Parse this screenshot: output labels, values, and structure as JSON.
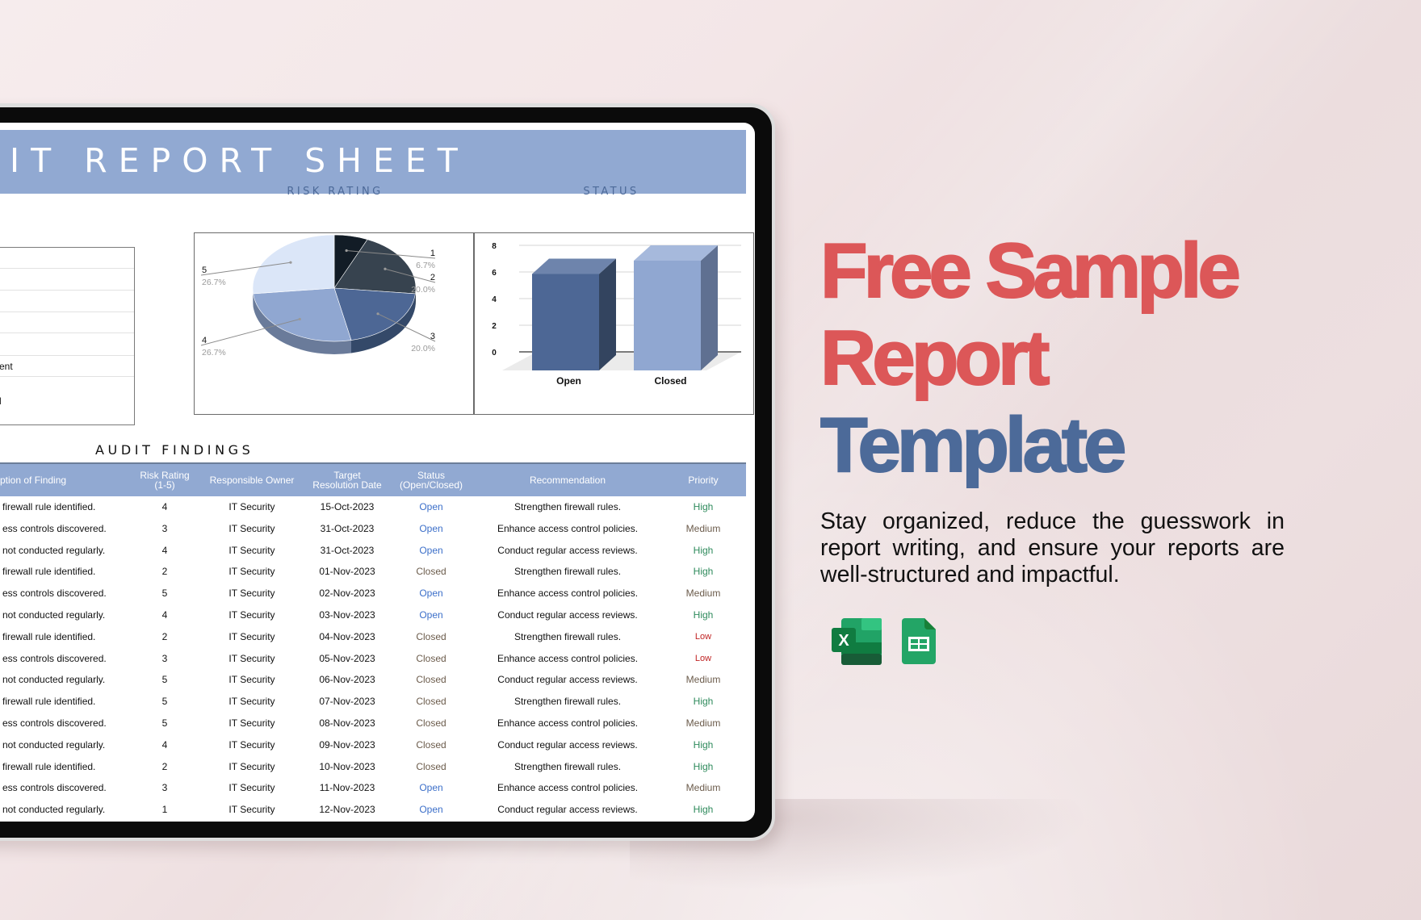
{
  "sheet": {
    "title": "IT REPORT SHEET",
    "risk_rating_label": "RISK RATING",
    "status_label": "STATUS",
    "summary_rows": [
      "",
      "",
      "",
      "",
      "",
      "ent",
      "l"
    ],
    "audit_findings_label": "AUDIT FINDINGS",
    "table": {
      "columns": [
        "ption of Finding",
        "Risk Rating\n(1-5)",
        "Responsible Owner",
        "Target\nResolution Date",
        "Status\n(Open/Closed)",
        "Recommendation",
        "Priority"
      ],
      "rows": [
        {
          "desc": "firewall rule identified.",
          "risk": "4",
          "owner": "IT Security",
          "date": "15-Oct-2023",
          "status": "Open",
          "rec": "Strengthen firewall rules.",
          "priority": "High"
        },
        {
          "desc": "ess controls discovered.",
          "risk": "3",
          "owner": "IT Security",
          "date": "31-Oct-2023",
          "status": "Open",
          "rec": "Enhance access control policies.",
          "priority": "Medium"
        },
        {
          "desc": "not conducted regularly.",
          "risk": "4",
          "owner": "IT Security",
          "date": "31-Oct-2023",
          "status": "Open",
          "rec": "Conduct regular access reviews.",
          "priority": "High"
        },
        {
          "desc": "firewall rule identified.",
          "risk": "2",
          "owner": "IT Security",
          "date": "01-Nov-2023",
          "status": "Closed",
          "rec": "Strengthen firewall rules.",
          "priority": "High"
        },
        {
          "desc": "ess controls discovered.",
          "risk": "5",
          "owner": "IT Security",
          "date": "02-Nov-2023",
          "status": "Open",
          "rec": "Enhance access control policies.",
          "priority": "Medium"
        },
        {
          "desc": "not conducted regularly.",
          "risk": "4",
          "owner": "IT Security",
          "date": "03-Nov-2023",
          "status": "Open",
          "rec": "Conduct regular access reviews.",
          "priority": "High"
        },
        {
          "desc": "firewall rule identified.",
          "risk": "2",
          "owner": "IT Security",
          "date": "04-Nov-2023",
          "status": "Closed",
          "rec": "Strengthen firewall rules.",
          "priority": "Low"
        },
        {
          "desc": "ess controls discovered.",
          "risk": "3",
          "owner": "IT Security",
          "date": "05-Nov-2023",
          "status": "Closed",
          "rec": "Enhance access control policies.",
          "priority": "Low"
        },
        {
          "desc": "not conducted regularly.",
          "risk": "5",
          "owner": "IT Security",
          "date": "06-Nov-2023",
          "status": "Closed",
          "rec": "Conduct regular access reviews.",
          "priority": "Medium"
        },
        {
          "desc": "firewall rule identified.",
          "risk": "5",
          "owner": "IT Security",
          "date": "07-Nov-2023",
          "status": "Closed",
          "rec": "Strengthen firewall rules.",
          "priority": "High"
        },
        {
          "desc": "ess controls discovered.",
          "risk": "5",
          "owner": "IT Security",
          "date": "08-Nov-2023",
          "status": "Closed",
          "rec": "Enhance access control policies.",
          "priority": "Medium"
        },
        {
          "desc": "not conducted regularly.",
          "risk": "4",
          "owner": "IT Security",
          "date": "09-Nov-2023",
          "status": "Closed",
          "rec": "Conduct regular access reviews.",
          "priority": "High"
        },
        {
          "desc": "firewall rule identified.",
          "risk": "2",
          "owner": "IT Security",
          "date": "10-Nov-2023",
          "status": "Closed",
          "rec": "Strengthen firewall rules.",
          "priority": "High"
        },
        {
          "desc": "ess controls discovered.",
          "risk": "3",
          "owner": "IT Security",
          "date": "11-Nov-2023",
          "status": "Open",
          "rec": "Enhance access control policies.",
          "priority": "Medium"
        },
        {
          "desc": "not conducted regularly.",
          "risk": "1",
          "owner": "IT Security",
          "date": "12-Nov-2023",
          "status": "Open",
          "rec": "Conduct regular access reviews.",
          "priority": "High"
        }
      ]
    }
  },
  "chart_data": [
    {
      "type": "pie",
      "title": "RISK RATING",
      "categories": [
        "1",
        "2",
        "3",
        "4",
        "5"
      ],
      "values": [
        1,
        3,
        3,
        4,
        4
      ],
      "percent_labels": [
        "6.7%",
        "20.0%",
        "20.0%",
        "26.7%",
        "26.7%"
      ],
      "colors": [
        "#121c26",
        "#37434f",
        "#4d6795",
        "#90a7d1",
        "#dbe6f8"
      ],
      "side_colors": [
        "#0b1118",
        "#262f38",
        "#344969",
        "#6a7b9a",
        "#a9b6cc"
      ],
      "three_d": true
    },
    {
      "type": "bar",
      "title": "STATUS",
      "categories": [
        "Open",
        "Closed"
      ],
      "values": [
        7,
        8
      ],
      "colors": [
        "#4d6795",
        "#90a7d1"
      ],
      "ylim": [
        0,
        8
      ],
      "yticks": [
        "0",
        "2",
        "4",
        "6",
        "8"
      ],
      "grid": true,
      "three_d": true
    }
  ],
  "promo": {
    "title_line1": "Free Sample",
    "title_line2": "Report",
    "title_line3": "Template",
    "description": "Stay organized, reduce the guesswork in report writing, and ensure your reports are well-structured and impactful.",
    "colors": {
      "red": "#dc5758",
      "blue": "#4c6a99"
    },
    "icons": [
      "excel-icon",
      "google-sheets-icon"
    ]
  }
}
